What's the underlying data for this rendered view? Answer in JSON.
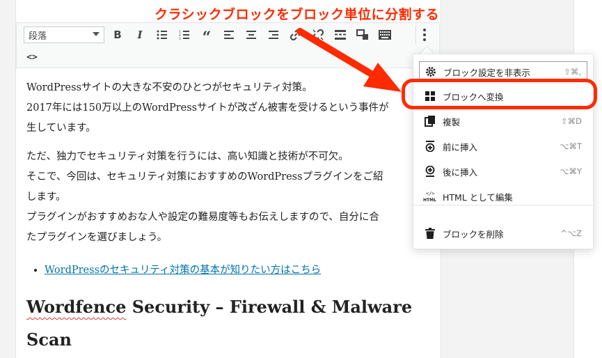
{
  "annotation": "クラシックブロックをブロック単位に分割する",
  "toolbar": {
    "format_select": "段落",
    "icons": [
      "bold-icon",
      "italic-icon",
      "bullet-list-icon",
      "numbered-list-icon",
      "blockquote-icon",
      "align-left-icon",
      "align-center-icon",
      "align-right-icon",
      "link-icon",
      "unlink-icon",
      "read-more-icon",
      "toolbar-toggle-icon",
      "keyboard-icon",
      "more-options-icon",
      "html-code-icon"
    ]
  },
  "content": {
    "p1_line1": "WordPressサイトの大きな不安のひとつがセキュリティ対策。",
    "p1_line2": "2017年には150万以上のWordPressサイトが改ざん被害を受けるという事件が",
    "p1_line3": "生しています。",
    "p2_line1": "ただ、独力でセキュリティ対策を行うには、高い知識と技術が不可欠。",
    "p2_line2": "そこで、今回は、セキュリティ対策におすすめのWordPressプラグインをご紹",
    "p2_line3": "します。",
    "p2_line4": "プラグインがおすすめおな人や設定の難易度等もお伝えしますので、自分に合",
    "p2_line5": "たプラグインを選びましょう。",
    "list_link": "WordPressのセキュリティ対策の基本が知りたい方はこちら",
    "heading_word1": "Wordfence",
    "heading_rest": " Security – Firewall & Malware",
    "heading_line2": "Scan"
  },
  "menu": {
    "items": [
      {
        "label": "ブロック設定を非表示",
        "shortcut": "⇧⌘,",
        "icon": "gear-icon"
      },
      {
        "label": "ブロックへ変換",
        "shortcut": "",
        "icon": "grid-icon"
      },
      {
        "label": "複製",
        "shortcut": "⇧⌘D",
        "icon": "duplicate-icon"
      },
      {
        "label": "前に挿入",
        "shortcut": "⌥⌘T",
        "icon": "insert-before-icon"
      },
      {
        "label": "後に挿入",
        "shortcut": "⌥⌘Y",
        "icon": "insert-after-icon"
      },
      {
        "label": "HTML として編集",
        "shortcut": "",
        "icon": "html-icon"
      },
      {
        "label": "ブロックを削除",
        "shortcut": "^⌥Z",
        "icon": "trash-icon"
      }
    ]
  },
  "colors": {
    "annotation": "#ff2a00",
    "link": "#0073aa"
  }
}
